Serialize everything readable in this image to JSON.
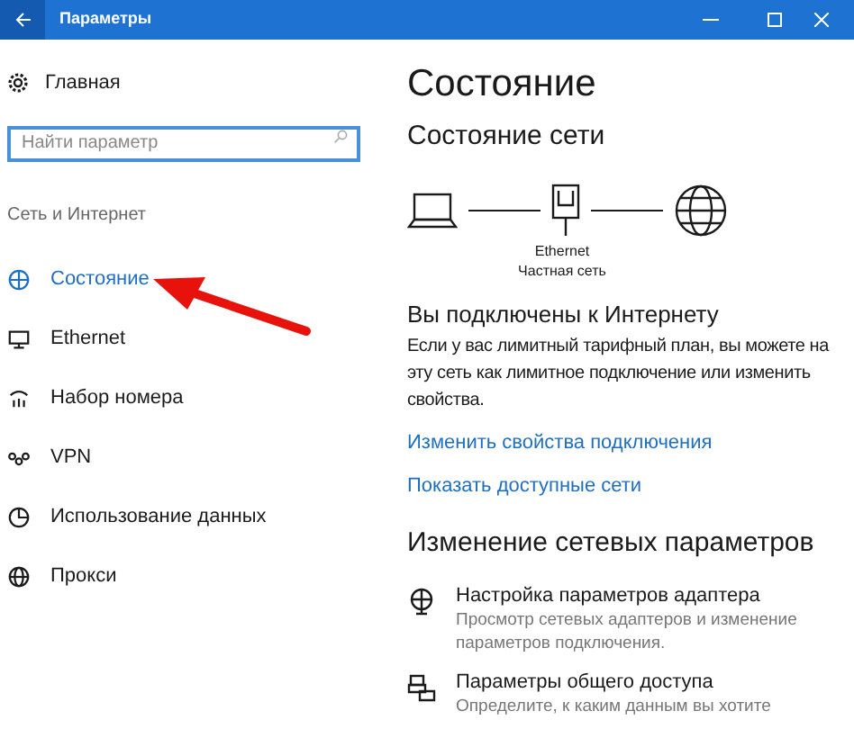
{
  "window": {
    "title": "Параметры"
  },
  "sidebar": {
    "home": "Главная",
    "search": {
      "placeholder": "Найти параметр"
    },
    "category": "Сеть и Интернет",
    "items": [
      {
        "label": "Состояние",
        "kind": "status",
        "selected": true
      },
      {
        "label": "Ethernet",
        "kind": "ethernet",
        "selected": false
      },
      {
        "label": "Набор номера",
        "kind": "dialup",
        "selected": false
      },
      {
        "label": "VPN",
        "kind": "vpn",
        "selected": false
      },
      {
        "label": "Использование данных",
        "kind": "data",
        "selected": false
      },
      {
        "label": "Прокси",
        "kind": "proxy",
        "selected": false
      }
    ]
  },
  "content": {
    "title": "Состояние",
    "network_heading": "Состояние сети",
    "diagram": {
      "adapter": "Ethernet",
      "network": "Частная сеть"
    },
    "connected_heading": "Вы подключены к Интернету",
    "description_lines": [
      "Если у вас лимитный тарифный план, вы можете на",
      "эту сеть как лимитное подключение или изменить",
      "свойства."
    ],
    "links": [
      "Изменить свойства подключения",
      "Показать доступные сети"
    ],
    "change_heading": "Изменение сетевых параметров",
    "options": [
      {
        "kind": "adapter",
        "title": "Настройка параметров адаптера",
        "description_lines": [
          "Просмотр сетевых адаптеров и изменение",
          "параметров подключения."
        ]
      },
      {
        "kind": "sharing",
        "title": "Параметры общего доступа",
        "description_lines": [
          "Определите, к каким данным вы хотите"
        ]
      }
    ]
  }
}
